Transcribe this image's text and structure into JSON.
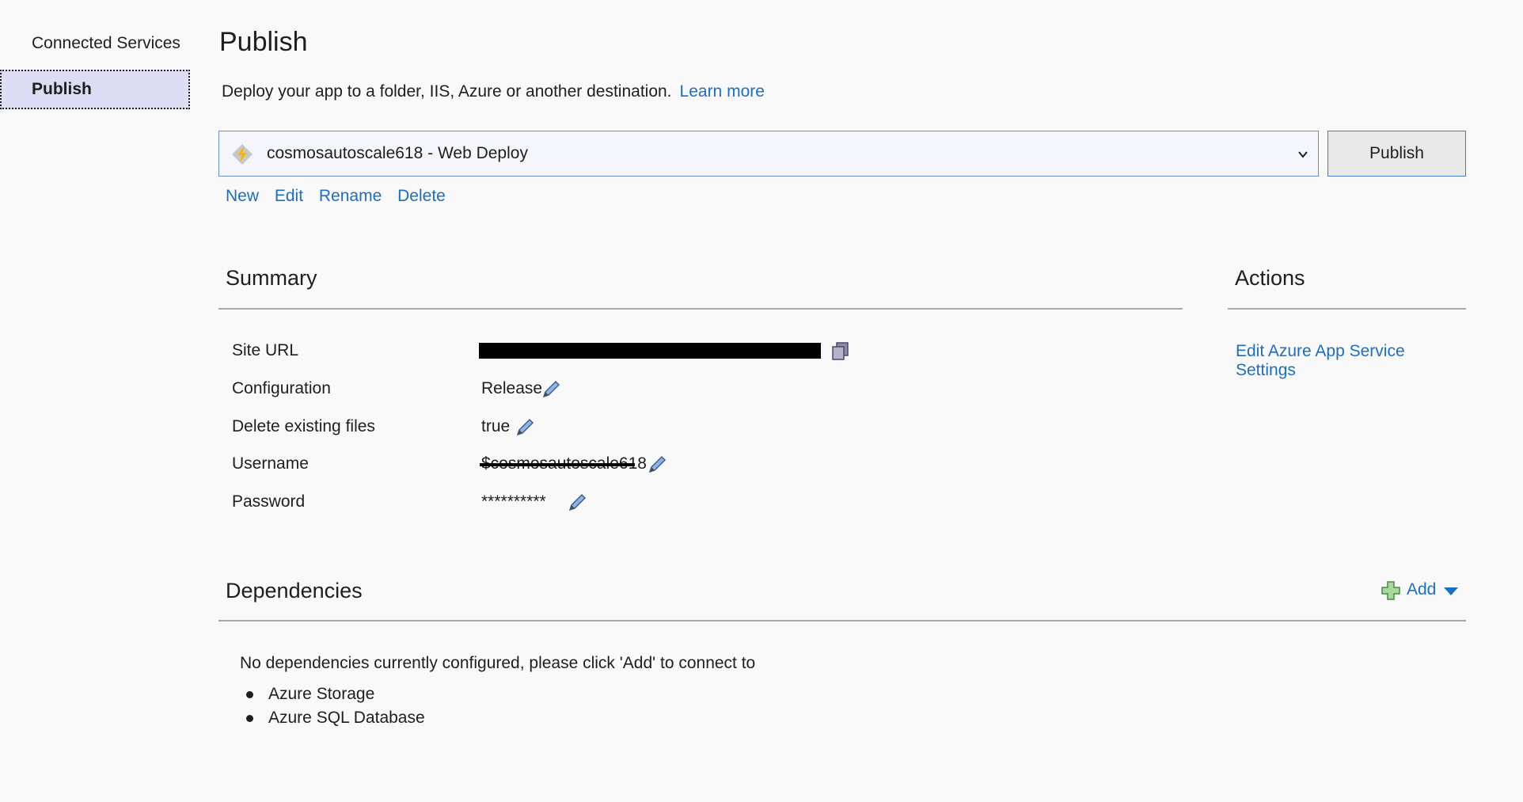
{
  "sidebar": {
    "items": [
      {
        "label": "Connected Services"
      },
      {
        "label": "Publish"
      }
    ]
  },
  "header": {
    "title": "Publish",
    "subtitle": "Deploy your app to a folder, IIS, Azure or another destination.",
    "learn_more": "Learn more"
  },
  "profile": {
    "selected": "cosmosautoscale618 - Web Deploy",
    "publish_label": "Publish",
    "links": {
      "new": "New",
      "edit": "Edit",
      "rename": "Rename",
      "delete": "Delete"
    }
  },
  "summary": {
    "title": "Summary",
    "rows": [
      {
        "label": "Site URL",
        "value": "",
        "redacted": true
      },
      {
        "label": "Configuration",
        "value": "Release"
      },
      {
        "label": "Delete existing files",
        "value": "true"
      },
      {
        "label": "Username",
        "value": "$cosmosautoscale618",
        "redacted": true
      },
      {
        "label": "Password",
        "value": "**********"
      }
    ]
  },
  "actions": {
    "title": "Actions",
    "edit_settings": "Edit Azure App Service Settings"
  },
  "dependencies": {
    "title": "Dependencies",
    "add_label": "Add",
    "empty_text": "No dependencies currently configured, please click 'Add' to connect to",
    "options": [
      "Azure Storage",
      "Azure SQL Database"
    ]
  },
  "colors": {
    "link": "#1a6ec6",
    "sidebar_active": "#dcdcf4",
    "rule": "#a8a8a8"
  }
}
